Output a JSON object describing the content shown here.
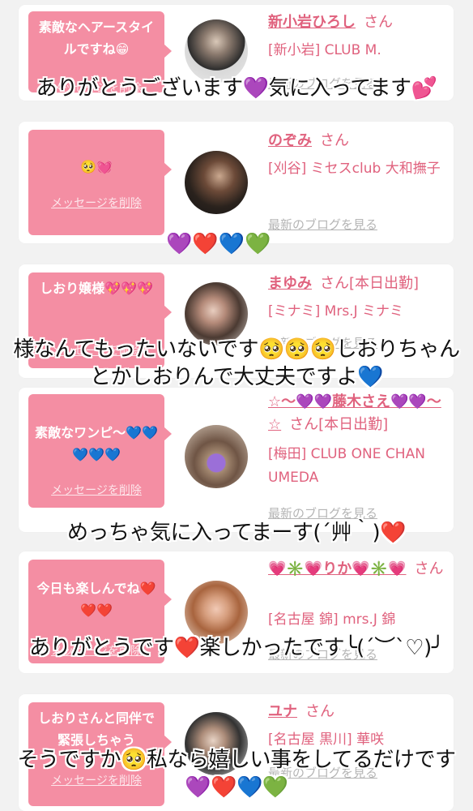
{
  "delete_label": "メッセージを削除",
  "blog_label": "最新のブログを見る",
  "san": "さん",
  "cards": [
    {
      "message": "素敵なヘアースタイルですね😁",
      "name": "新小岩ひろし",
      "extra": "",
      "shop": "[新小岩] CLUB M."
    },
    {
      "message": "🥺💓",
      "name": "のぞみ",
      "extra": "",
      "shop": "[刈谷] ミセスclub 大和撫子"
    },
    {
      "message": "しおり嬢様💖💖💖",
      "name": "まゆみ",
      "extra": "[本日出勤]",
      "shop": "[ミナミ] Mrs.J ミナミ"
    },
    {
      "message": "素敵なワンピ〜💙💙💙💙💙",
      "name": "☆〜💜💜藤木さえ💜💜〜☆",
      "extra": "[本日出勤]",
      "shop": "[梅田] CLUB ONE CHAN UMEDA"
    },
    {
      "message": "今日も楽しんでね❤️❤️❤️",
      "name": "💗✳️💗りか💗✳️💗",
      "extra": "",
      "shop": "[名古屋 錦] mrs.J 錦"
    },
    {
      "message": "しおりさんと同伴で緊張しちゃう",
      "name": "ユナ",
      "extra": "",
      "shop": "[名古屋 黒川] 華咲"
    }
  ],
  "replies": [
    "ありがとうございます💜気に入ってます💕",
    "💜❤️💙💚",
    "様なんてもったいないです🥺🥺🥺しおりちゃんとかしおりんで大丈夫ですよ💙",
    "めっちゃ気に入ってまーす(´艸｀)❤️",
    "ありがとうです❤️楽しかったです╰(´︶`♡)╯",
    "そうですか🥺私なら嬉しい事をしてるだけです💜❤️💙💚"
  ]
}
